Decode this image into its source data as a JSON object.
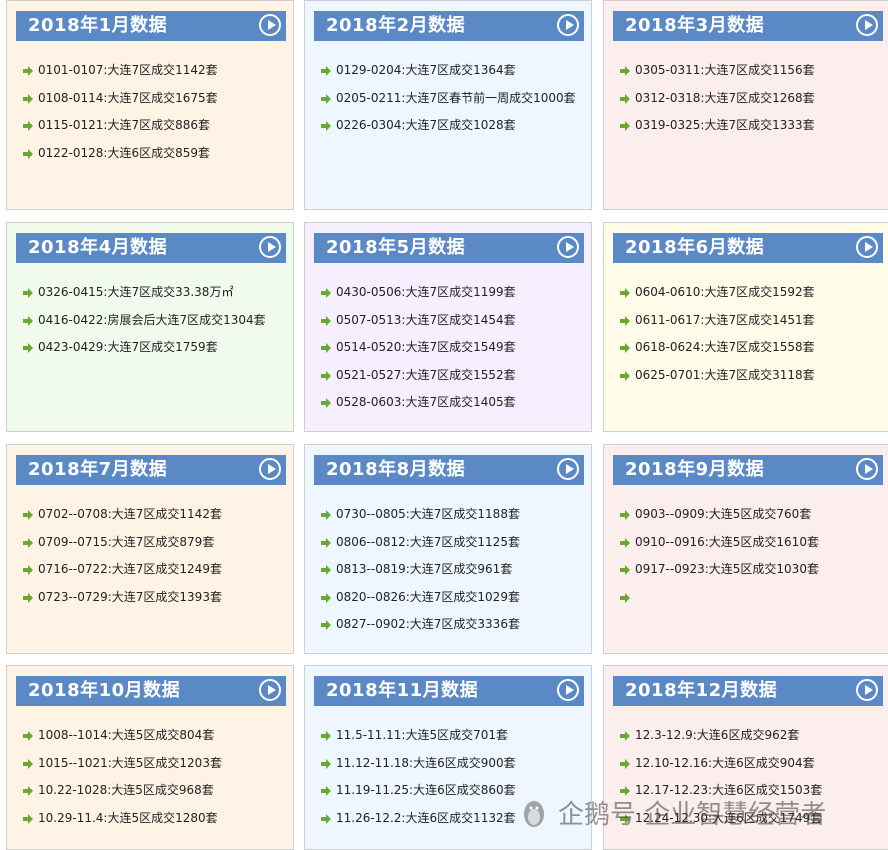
{
  "cards": [
    {
      "title": "2018年1月数据",
      "bg": "#fff3e6",
      "items": [
        "0101-0107:大连7区成交1142套",
        "0108-0114:大连7区成交1675套",
        "0115-0121:大连7区成交886套",
        "0122-0128:大连6区成交859套"
      ]
    },
    {
      "title": "2018年2月数据",
      "bg": "#eef7ff",
      "items": [
        "0129-0204:大连7区成交1364套",
        "0205-0211:大连7区春节前一周成交1000套",
        "0226-0304:大连7区成交1028套"
      ]
    },
    {
      "title": "2018年3月数据",
      "bg": "#fdeeee",
      "items": [
        "0305-0311:大连7区成交1156套",
        "0312-0318:大连7区成交1268套",
        "0319-0325:大连7区成交1333套"
      ]
    },
    {
      "title": "2018年4月数据",
      "bg": "#f0fbee",
      "items": [
        "0326-0415:大连7区成交33.38万㎡",
        "0416-0422:房展会后大连7区成交1304套",
        "0423-0429:大连7区成交1759套"
      ]
    },
    {
      "title": "2018年5月数据",
      "bg": "#f5efff",
      "items": [
        "0430-0506:大连7区成交1199套",
        "0507-0513:大连7区成交1454套",
        "0514-0520:大连7区成交1549套",
        "0521-0527:大连7区成交1552套",
        "0528-0603:大连7区成交1405套"
      ]
    },
    {
      "title": "2018年6月数据",
      "bg": "#fffbe9",
      "items": [
        "0604-0610:大连7区成交1592套",
        "0611-0617:大连7区成交1451套",
        "0618-0624:大连7区成交1558套",
        "0625-0701:大连7区成交3118套"
      ]
    },
    {
      "title": "2018年7月数据",
      "bg": "#fff3e6",
      "items": [
        "0702--0708:大连7区成交1142套",
        "0709--0715:大连7区成交879套",
        "0716--0722:大连7区成交1249套",
        "0723--0729:大连7区成交1393套"
      ]
    },
    {
      "title": "2018年8月数据",
      "bg": "#eef7ff",
      "items": [
        "0730--0805:大连7区成交1188套",
        "0806--0812:大连7区成交1125套",
        "0813--0819:大连7区成交961套",
        "0820--0826:大连7区成交1029套",
        "0827--0902:大连7区成交3336套"
      ]
    },
    {
      "title": "2018年9月数据",
      "bg": "#fdeeee",
      "items": [
        "0903--0909:大连5区成交760套",
        "0910--0916:大连5区成交1610套",
        "0917--0923:大连5区成交1030套",
        ""
      ]
    },
    {
      "title": "2018年10月数据",
      "bg": "#fff3e6",
      "items": [
        "1008--1014:大连5区成交804套",
        "1015--1021:大连5区成交1203套",
        "10.22-1028:大连5区成交968套",
        "10.29-11.4:大连5区成交1280套"
      ]
    },
    {
      "title": "2018年11月数据",
      "bg": "#eef7ff",
      "items": [
        "11.5-11.11:大连5区成交701套",
        "11.12-11.18:大连6区成交900套",
        "11.19-11.25:大连6区成交860套",
        "11.26-12.2:大连6区成交1132套"
      ]
    },
    {
      "title": "2018年12月数据",
      "bg": "#fdeeee",
      "items": [
        "12.3-12.9:大连6区成交962套",
        "12.10-12.16:大连6区成交904套",
        "12.17-12.23:大连6区成交1503套",
        "12.24-12.30:大连6区成交1749套"
      ]
    }
  ],
  "colors": {
    "header_bg": "#5a89c6",
    "arrow": "#6aa92f",
    "text": "#222222"
  },
  "watermark": {
    "text": "企鹅号 企业智慧经营者"
  }
}
